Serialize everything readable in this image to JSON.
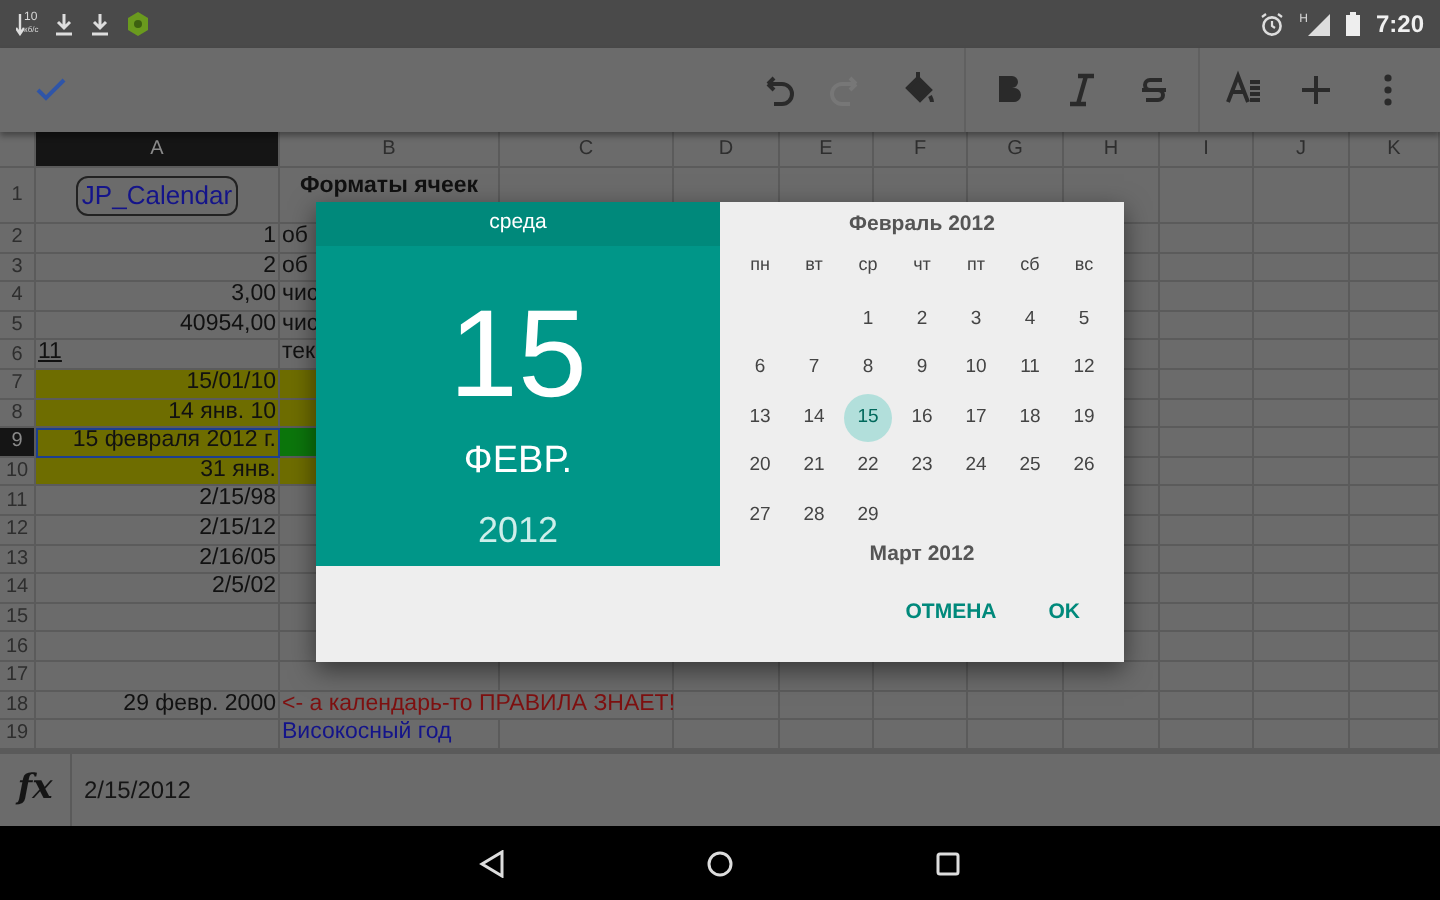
{
  "status_bar": {
    "speed": "10",
    "speed_unit": "кб/с",
    "time": "7:20",
    "network_type": "H"
  },
  "toolbar": {
    "tools": [
      {
        "kind": "check",
        "disabled": false
      },
      {
        "kind": "undo",
        "disabled": false
      },
      {
        "kind": "redo",
        "disabled": true
      },
      {
        "kind": "fill",
        "disabled": false
      },
      {
        "kind": "bold",
        "disabled": false
      },
      {
        "kind": "italic",
        "disabled": false
      },
      {
        "kind": "strike",
        "disabled": false
      },
      {
        "kind": "format",
        "disabled": false
      },
      {
        "kind": "add",
        "disabled": false
      },
      {
        "kind": "more",
        "disabled": false
      }
    ]
  },
  "sheet": {
    "columns": [
      {
        "label": "A",
        "selected": true
      },
      {
        "label": "B",
        "selected": false
      },
      {
        "label": "C",
        "selected": false
      },
      {
        "label": "D",
        "selected": false
      },
      {
        "label": "E",
        "selected": false
      },
      {
        "label": "F",
        "selected": false
      },
      {
        "label": "G",
        "selected": false
      },
      {
        "label": "H",
        "selected": false
      },
      {
        "label": "I",
        "selected": false
      },
      {
        "label": "J",
        "selected": false
      },
      {
        "label": "K",
        "selected": false
      }
    ],
    "rows": [
      {
        "header": "1",
        "selected": false,
        "a": {
          "text": "JP_Calendar",
          "kind": "button"
        },
        "b": {
          "text": "Форматы ячеек",
          "kind": "heading"
        }
      },
      {
        "header": "2",
        "selected": false,
        "a": {
          "text": "1",
          "kind": "number"
        },
        "b": {
          "text": "об",
          "kind": "text"
        }
      },
      {
        "header": "3",
        "selected": false,
        "a": {
          "text": "2",
          "kind": "number"
        },
        "b": {
          "text": "об",
          "kind": "text"
        }
      },
      {
        "header": "4",
        "selected": false,
        "a": {
          "text": "3,00",
          "kind": "number"
        },
        "b": {
          "text": "чис",
          "kind": "text"
        }
      },
      {
        "header": "5",
        "selected": false,
        "a": {
          "text": "40954,00",
          "kind": "number"
        },
        "b": {
          "text": "чис",
          "kind": "text"
        }
      },
      {
        "header": "6",
        "selected": false,
        "a": {
          "text": "11",
          "kind": "text"
        },
        "b": {
          "text": "тек",
          "kind": "text"
        }
      },
      {
        "header": "7",
        "selected": false,
        "a": {
          "text": "15/01/10",
          "kind": "number",
          "color": "#6e6d00"
        },
        "b": {
          "color": "#6e6d00"
        }
      },
      {
        "header": "8",
        "selected": false,
        "a": {
          "text": "14 янв. 10",
          "kind": "number",
          "color": "#6e6d00"
        },
        "b": {
          "color": "#6e6d00"
        }
      },
      {
        "header": "9",
        "selected": true,
        "a": {
          "text": "15 февраля 2012 г.",
          "kind": "number",
          "color": "#6e6d00"
        },
        "b": {
          "color": "#0c760c"
        }
      },
      {
        "header": "10",
        "selected": false,
        "a": {
          "text": "31 янв.",
          "kind": "number",
          "color": "#6e6d00"
        },
        "b": {
          "color": "#6e6d00"
        }
      },
      {
        "header": "11",
        "selected": false,
        "a": {
          "text": "2/15/98",
          "kind": "number"
        }
      },
      {
        "header": "12",
        "selected": false,
        "a": {
          "text": "2/15/12",
          "kind": "number"
        }
      },
      {
        "header": "13",
        "selected": false,
        "a": {
          "text": "2/16/05",
          "kind": "number"
        }
      },
      {
        "header": "14",
        "selected": false,
        "a": {
          "text": "2/5/02",
          "kind": "number"
        }
      },
      {
        "header": "15",
        "selected": false
      },
      {
        "header": "16",
        "selected": false
      },
      {
        "header": "17",
        "selected": false
      },
      {
        "header": "18",
        "selected": false,
        "a": {
          "text": "29 февр. 2000",
          "kind": "number"
        },
        "b": {
          "text": "<- а календарь-то ПРАВИЛА ЗНАЕТ!",
          "kind": "warning"
        }
      },
      {
        "header": "19",
        "selected": false,
        "b": {
          "text": "Високосный год",
          "kind": "note"
        }
      }
    ]
  },
  "formula_bar": {
    "function_label": "fx",
    "value": "2/15/2012"
  },
  "date_dialog": {
    "weekday": "среда",
    "day": "15",
    "month": "ФЕВР.",
    "year": "2012",
    "month_title": "Февраль 2012",
    "weekday_labels": [
      "пн",
      "вт",
      "ср",
      "чт",
      "пт",
      "сб",
      "вс"
    ],
    "weeks": [
      [
        {
          "label": "1",
          "selected": false
        },
        {
          "label": "2",
          "selected": false
        },
        {
          "label": "3",
          "selected": false
        },
        {
          "label": "4",
          "selected": false
        },
        {
          "label": "5",
          "selected": false
        }
      ],
      [
        {
          "label": "6",
          "selected": false
        },
        {
          "label": "7",
          "selected": false
        },
        {
          "label": "8",
          "selected": false
        },
        {
          "label": "9",
          "selected": false
        },
        {
          "label": "10",
          "selected": false
        },
        {
          "label": "11",
          "selected": false
        },
        {
          "label": "12",
          "selected": false
        }
      ],
      [
        {
          "label": "13",
          "selected": false
        },
        {
          "label": "14",
          "selected": false
        },
        {
          "label": "15",
          "selected": true
        },
        {
          "label": "16",
          "selected": false
        },
        {
          "label": "17",
          "selected": false
        },
        {
          "label": "18",
          "selected": false
        },
        {
          "label": "19",
          "selected": false
        }
      ],
      [
        {
          "label": "20",
          "selected": false
        },
        {
          "label": "21",
          "selected": false
        },
        {
          "label": "22",
          "selected": false
        },
        {
          "label": "23",
          "selected": false
        },
        {
          "label": "24",
          "selected": false
        },
        {
          "label": "25",
          "selected": false
        },
        {
          "label": "26",
          "selected": false
        }
      ],
      [
        {
          "label": "27",
          "selected": false
        },
        {
          "label": "28",
          "selected": false
        },
        {
          "label": "29",
          "selected": false
        }
      ]
    ],
    "next_month_title": "Март 2012",
    "buttons": [
      "ОТМЕНА",
      "OK"
    ]
  }
}
